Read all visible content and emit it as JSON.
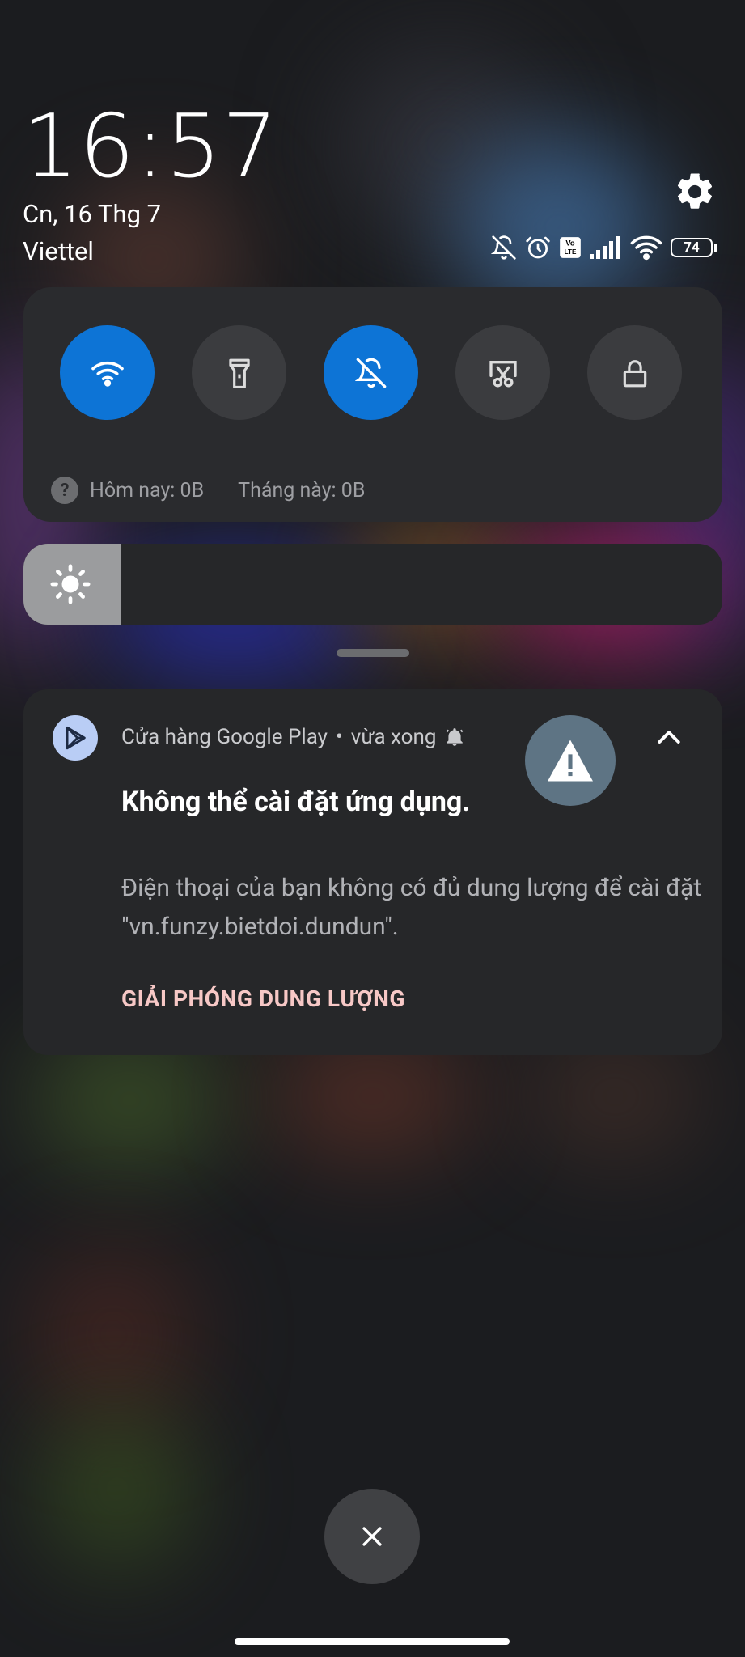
{
  "status_bar": {
    "time": "16:57",
    "date": "Cn, 16 Thg 7",
    "carrier": "Viettel",
    "battery_level": "74",
    "icons": [
      "bell-off-icon",
      "alarm-icon",
      "volte-icon",
      "signal-icon",
      "wifi-icon",
      "battery-icon"
    ]
  },
  "quick_settings": {
    "tiles": [
      {
        "name": "wifi",
        "icon": "wifi-icon",
        "active": true
      },
      {
        "name": "flashlight",
        "icon": "flashlight-icon",
        "active": false
      },
      {
        "name": "silent",
        "icon": "bell-off-icon",
        "active": true
      },
      {
        "name": "screenshot",
        "icon": "scissors-icon",
        "active": false
      },
      {
        "name": "lock",
        "icon": "lock-icon",
        "active": false
      }
    ],
    "data_today": "Hôm nay: 0B",
    "data_month": "Tháng này: 0B"
  },
  "brightness": {
    "level": 0.14,
    "icon": "sun-icon"
  },
  "notification": {
    "app_name": "Cửa hàng Google Play",
    "separator": "•",
    "time": "vừa xong",
    "title": "Không thể cài đặt ứng dụng.",
    "body": "Điện thoại của bạn không có đủ dung lượng để cài đặt \"vn.funzy.bietdoi.dundun\".",
    "action_label": "GIẢI PHÓNG DUNG LƯỢNG"
  },
  "colors": {
    "active_tile": "#0d74d6",
    "action_text": "#f7c8c6",
    "warning_badge": "#5e7484"
  }
}
